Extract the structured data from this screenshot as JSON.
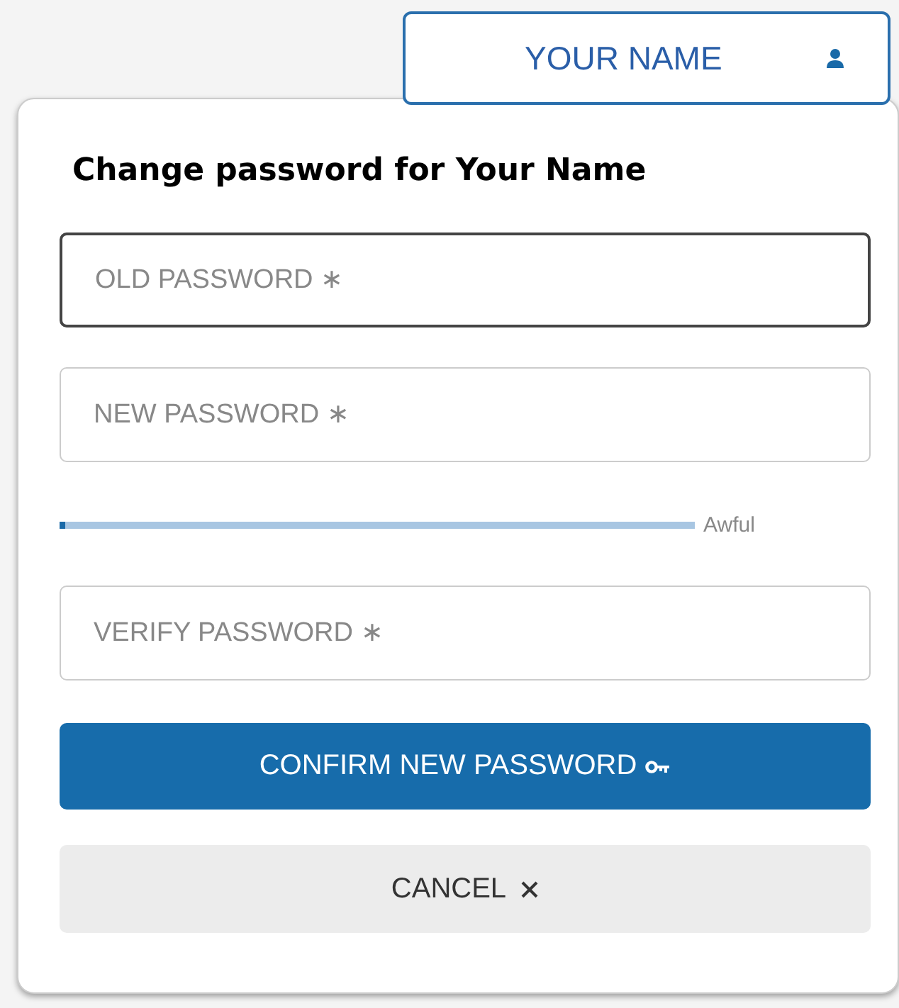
{
  "user_button": {
    "label": "YOUR NAME"
  },
  "dialog": {
    "title": "Change password for Your Name",
    "fields": [
      {
        "placeholder": "OLD PASSWORD ∗",
        "focused": true
      },
      {
        "placeholder": "NEW PASSWORD ∗",
        "focused": false
      },
      {
        "placeholder": "VERIFY PASSWORD ∗",
        "focused": false
      }
    ],
    "strength": {
      "level": 0.01,
      "label": "Awful"
    },
    "confirm_button": {
      "label": "CONFIRM NEW PASSWORD"
    },
    "cancel_button": {
      "label": "CANCEL"
    }
  }
}
